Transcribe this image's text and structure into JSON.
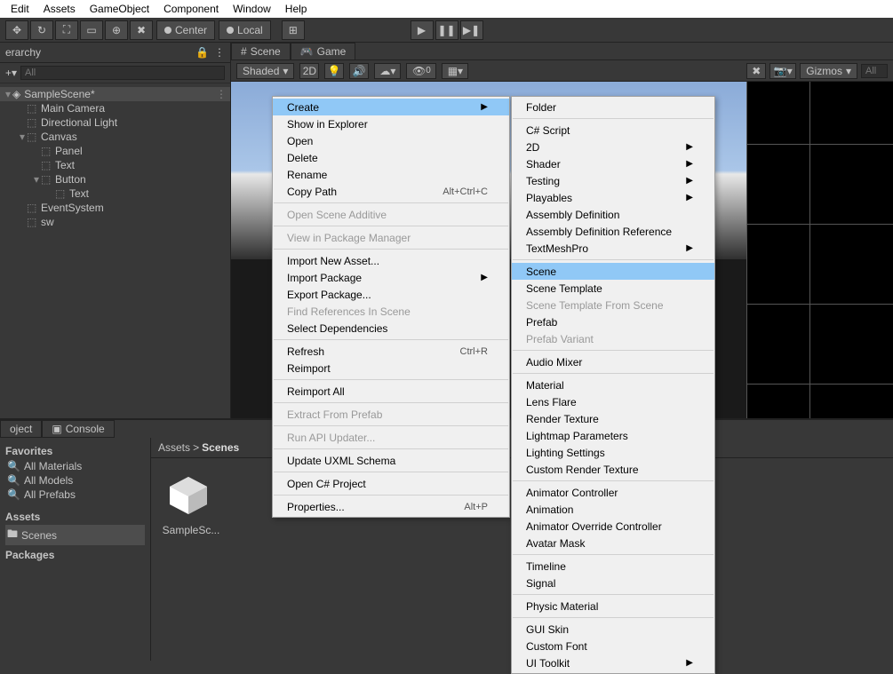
{
  "menubar": [
    "Edit",
    "Assets",
    "GameObject",
    "Component",
    "Window",
    "Help"
  ],
  "toolbar": {
    "center": "Center",
    "local": "Local"
  },
  "hierarchy": {
    "title": "erarchy",
    "search_placeholder": "All",
    "scene": "SampleScene*",
    "items": [
      {
        "label": "Main Camera",
        "indent": 1
      },
      {
        "label": "Directional Light",
        "indent": 1
      },
      {
        "label": "Canvas",
        "indent": 1,
        "arrow": true
      },
      {
        "label": "Panel",
        "indent": 2
      },
      {
        "label": "Text",
        "indent": 2
      },
      {
        "label": "Button",
        "indent": 2,
        "arrow": true
      },
      {
        "label": "Text",
        "indent": 3
      },
      {
        "label": "EventSystem",
        "indent": 1
      },
      {
        "label": "sw",
        "indent": 1
      }
    ]
  },
  "scene": {
    "tabs": [
      "Scene",
      "Game"
    ],
    "shading": "Shaded",
    "mode2d": "2D",
    "gizmos": "Gizmos",
    "zero": "0",
    "search_placeholder": "All"
  },
  "project": {
    "tabs": [
      "oject",
      "Console"
    ],
    "favorites_label": "Favorites",
    "favorites": [
      "All Materials",
      "All Models",
      "All Prefabs"
    ],
    "assets_label": "Assets",
    "assets": [
      "Scenes"
    ],
    "packages_label": "Packages",
    "breadcrumb_root": "Assets",
    "breadcrumb_sep": ">",
    "breadcrumb_leaf": "Scenes",
    "folder_item": "SampleSc..."
  },
  "menu1": [
    {
      "label": "Create",
      "arrow": true,
      "hl": true
    },
    {
      "label": "Show in Explorer"
    },
    {
      "label": "Open"
    },
    {
      "label": "Delete"
    },
    {
      "label": "Rename"
    },
    {
      "label": "Copy Path",
      "shortcut": "Alt+Ctrl+C"
    },
    {
      "sep": true
    },
    {
      "label": "Open Scene Additive",
      "disabled": true
    },
    {
      "sep": true
    },
    {
      "label": "View in Package Manager",
      "disabled": true
    },
    {
      "sep": true
    },
    {
      "label": "Import New Asset..."
    },
    {
      "label": "Import Package",
      "arrow": true
    },
    {
      "label": "Export Package..."
    },
    {
      "label": "Find References In Scene",
      "disabled": true
    },
    {
      "label": "Select Dependencies"
    },
    {
      "sep": true
    },
    {
      "label": "Refresh",
      "shortcut": "Ctrl+R"
    },
    {
      "label": "Reimport"
    },
    {
      "sep": true
    },
    {
      "label": "Reimport All"
    },
    {
      "sep": true
    },
    {
      "label": "Extract From Prefab",
      "disabled": true
    },
    {
      "sep": true
    },
    {
      "label": "Run API Updater...",
      "disabled": true
    },
    {
      "sep": true
    },
    {
      "label": "Update UXML Schema"
    },
    {
      "sep": true
    },
    {
      "label": "Open C# Project"
    },
    {
      "sep": true
    },
    {
      "label": "Properties...",
      "shortcut": "Alt+P"
    }
  ],
  "menu2": [
    {
      "label": "Folder"
    },
    {
      "sep": true
    },
    {
      "label": "C# Script"
    },
    {
      "label": "2D",
      "arrow": true
    },
    {
      "label": "Shader",
      "arrow": true
    },
    {
      "label": "Testing",
      "arrow": true
    },
    {
      "label": "Playables",
      "arrow": true
    },
    {
      "label": "Assembly Definition"
    },
    {
      "label": "Assembly Definition Reference"
    },
    {
      "label": "TextMeshPro",
      "arrow": true
    },
    {
      "sep": true
    },
    {
      "label": "Scene",
      "hl": true
    },
    {
      "label": "Scene Template"
    },
    {
      "label": "Scene Template From Scene",
      "disabled": true
    },
    {
      "label": "Prefab"
    },
    {
      "label": "Prefab Variant",
      "disabled": true
    },
    {
      "sep": true
    },
    {
      "label": "Audio Mixer"
    },
    {
      "sep": true
    },
    {
      "label": "Material"
    },
    {
      "label": "Lens Flare"
    },
    {
      "label": "Render Texture"
    },
    {
      "label": "Lightmap Parameters"
    },
    {
      "label": "Lighting Settings"
    },
    {
      "label": "Custom Render Texture"
    },
    {
      "sep": true
    },
    {
      "label": "Animator Controller"
    },
    {
      "label": "Animation"
    },
    {
      "label": "Animator Override Controller"
    },
    {
      "label": "Avatar Mask"
    },
    {
      "sep": true
    },
    {
      "label": "Timeline"
    },
    {
      "label": "Signal"
    },
    {
      "sep": true
    },
    {
      "label": "Physic Material"
    },
    {
      "sep": true
    },
    {
      "label": "GUI Skin"
    },
    {
      "label": "Custom Font"
    },
    {
      "label": "UI Toolkit",
      "arrow": true
    }
  ]
}
